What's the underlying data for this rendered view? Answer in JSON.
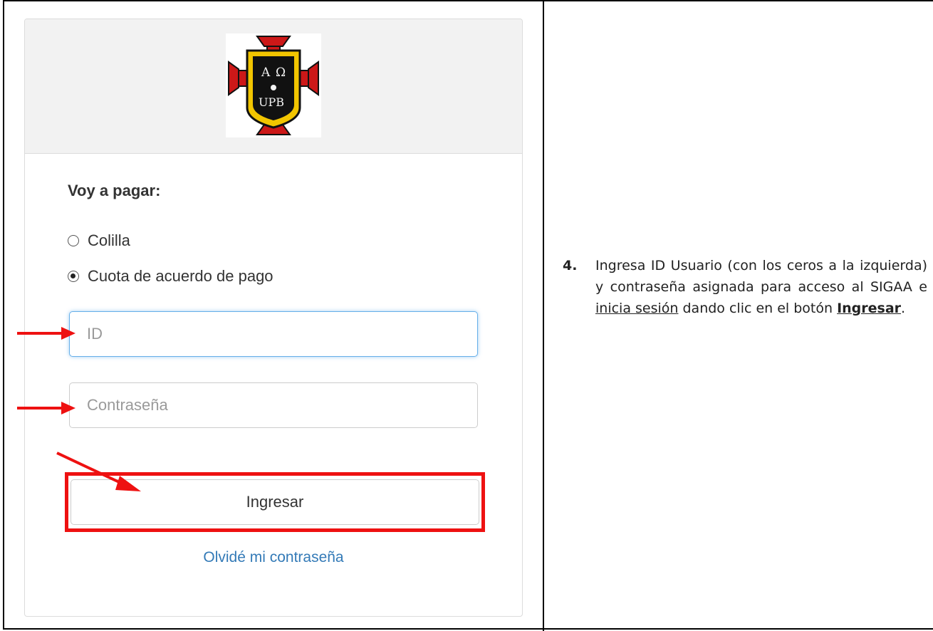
{
  "logo": {
    "letters": [
      "A",
      "Ω",
      "UPB"
    ],
    "colors": {
      "cross": "#cc1818",
      "shield": "#f2c500",
      "inner": "#111111"
    }
  },
  "form": {
    "heading": "Voy a pagar:",
    "options": [
      {
        "label": "Colilla",
        "selected": false
      },
      {
        "label": "Cuota de acuerdo de pago",
        "selected": true
      }
    ],
    "id_placeholder": "ID",
    "password_placeholder": "Contraseña",
    "submit_label": "Ingresar",
    "forgot_label": "Olvidé mi contraseña"
  },
  "instruction": {
    "number": "4.",
    "text_1": "Ingresa ID Usuario (con los ceros a la izquierda) y contraseña asignada para acceso al SIGAA e ",
    "link_text": "inicia sesión",
    "text_2": " dando clic en el botón ",
    "bold_text": "Ingresar",
    "text_3": "."
  },
  "colors": {
    "annotation": "#ee1111",
    "link": "#337ab7",
    "focus": "#66afe9"
  }
}
